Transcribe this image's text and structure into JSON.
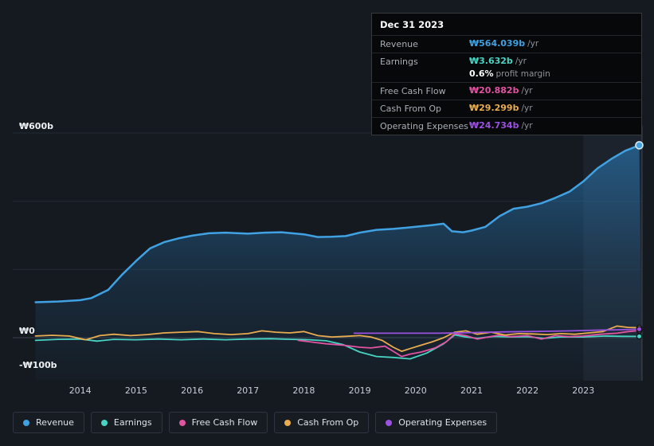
{
  "colors": {
    "revenue": "#40a2e3",
    "earnings": "#47d4c3",
    "free_cash_flow": "#e253a2",
    "cash_from_op": "#e9ac4f",
    "operating_expenses": "#9b51e0"
  },
  "tooltip": {
    "date": "Dec 31 2023",
    "rows": [
      {
        "label": "Revenue",
        "value": "₩564.039b",
        "suffix": "/yr"
      },
      {
        "label": "Earnings",
        "value": "₩3.632b",
        "suffix": "/yr"
      },
      {
        "label": "Free Cash Flow",
        "value": "₩20.882b",
        "suffix": "/yr"
      },
      {
        "label": "Cash From Op",
        "value": "₩29.299b",
        "suffix": "/yr"
      },
      {
        "label": "Operating Expenses",
        "value": "₩24.734b",
        "suffix": "/yr"
      }
    ],
    "margin": {
      "value": "0.6%",
      "label": "profit margin"
    }
  },
  "legend": {
    "items": [
      {
        "label": "Revenue"
      },
      {
        "label": "Earnings"
      },
      {
        "label": "Free Cash Flow"
      },
      {
        "label": "Cash From Op"
      },
      {
        "label": "Operating Expenses"
      }
    ]
  },
  "chart_data": {
    "type": "line",
    "title": "",
    "currency_unit": "₩ billions /yr",
    "x_axis": {
      "range": [
        2012.85,
        2024.05
      ],
      "ticks": [
        "2014",
        "2015",
        "2016",
        "2017",
        "2018",
        "2019",
        "2020",
        "2021",
        "2022",
        "2023"
      ],
      "tick_values": [
        2014,
        2015,
        2016,
        2017,
        2018,
        2019,
        2020,
        2021,
        2022,
        2023
      ]
    },
    "y_axis": {
      "range": [
        -120,
        640
      ],
      "gridlines": [
        600,
        400,
        200,
        0
      ],
      "labels": [
        {
          "text": "₩600b",
          "value": 600
        },
        {
          "text": "₩0",
          "value": 0
        },
        {
          "text": "-₩100b",
          "value": -100
        }
      ]
    },
    "highlight_from_x": 2023,
    "series": [
      {
        "name": "Revenue",
        "color": "#40a2e3",
        "fill": true,
        "x": [
          2013.2,
          2013.6,
          2014.0,
          2014.2,
          2014.5,
          2014.75,
          2015.0,
          2015.25,
          2015.5,
          2015.75,
          2016.0,
          2016.3,
          2016.6,
          2017.0,
          2017.3,
          2017.6,
          2018.0,
          2018.25,
          2018.5,
          2018.75,
          2019.0,
          2019.3,
          2019.6,
          2020.0,
          2020.3,
          2020.5,
          2020.65,
          2020.85,
          2021.0,
          2021.25,
          2021.5,
          2021.75,
          2022.0,
          2022.25,
          2022.5,
          2022.75,
          2023.0,
          2023.25,
          2023.5,
          2023.75,
          2024.0
        ],
        "values": [
          104,
          106,
          110,
          116,
          140,
          185,
          225,
          262,
          280,
          291,
          299,
          306,
          308,
          305,
          308,
          309,
          303,
          295,
          296,
          298,
          308,
          316,
          319,
          325,
          330,
          334,
          312,
          309,
          314,
          325,
          356,
          378,
          384,
          394,
          410,
          428,
          458,
          496,
          524,
          548,
          564.039
        ]
      },
      {
        "name": "Earnings",
        "color": "#47d4c3",
        "x": [
          2013.2,
          2013.6,
          2014.0,
          2014.3,
          2014.6,
          2015.0,
          2015.4,
          2015.8,
          2016.2,
          2016.6,
          2017.0,
          2017.4,
          2017.8,
          2018.1,
          2018.4,
          2018.7,
          2019.0,
          2019.3,
          2019.6,
          2019.9,
          2020.2,
          2020.5,
          2020.7,
          2020.9,
          2021.1,
          2021.4,
          2021.7,
          2022.0,
          2022.3,
          2022.6,
          2023.0,
          2023.4,
          2023.7,
          2024.0
        ],
        "values": [
          -8,
          -5,
          -4,
          -10,
          -5,
          -6,
          -4,
          -6,
          -4,
          -6,
          -4,
          -3,
          -5,
          -6,
          -9,
          -20,
          -42,
          -55,
          -58,
          -62,
          -45,
          -18,
          8,
          2,
          -2,
          4,
          2,
          3,
          -2,
          2,
          2,
          5,
          4,
          3.632
        ]
      },
      {
        "name": "Free Cash Flow",
        "color": "#e253a2",
        "x": [
          2017.9,
          2018.1,
          2018.4,
          2018.7,
          2019.0,
          2019.2,
          2019.45,
          2019.6,
          2019.75,
          2019.9,
          2020.1,
          2020.35,
          2020.55,
          2020.7,
          2020.9,
          2021.1,
          2021.3,
          2021.5,
          2021.7,
          2022.0,
          2022.25,
          2022.5,
          2022.75,
          2023.0,
          2023.3,
          2023.6,
          2023.8,
          2024.0
        ],
        "values": [
          -8,
          -12,
          -18,
          -22,
          -28,
          -30,
          -25,
          -40,
          -55,
          -48,
          -42,
          -30,
          -12,
          12,
          6,
          -4,
          2,
          8,
          3,
          6,
          -4,
          6,
          3,
          5,
          10,
          13,
          18,
          20.882
        ]
      },
      {
        "name": "Cash From Op",
        "color": "#e9ac4f",
        "x": [
          2013.2,
          2013.5,
          2013.8,
          2014.1,
          2014.35,
          2014.6,
          2014.9,
          2015.2,
          2015.5,
          2015.8,
          2016.1,
          2016.4,
          2016.7,
          2017.0,
          2017.25,
          2017.5,
          2017.75,
          2018.0,
          2018.25,
          2018.5,
          2018.75,
          2019.0,
          2019.2,
          2019.4,
          2019.6,
          2019.75,
          2019.9,
          2020.1,
          2020.3,
          2020.5,
          2020.7,
          2020.9,
          2021.1,
          2021.35,
          2021.6,
          2021.85,
          2022.1,
          2022.35,
          2022.6,
          2022.85,
          2023.1,
          2023.35,
          2023.6,
          2023.8,
          2024.0
        ],
        "values": [
          5,
          7,
          5,
          -6,
          6,
          10,
          6,
          9,
          14,
          16,
          18,
          12,
          9,
          12,
          20,
          16,
          14,
          18,
          6,
          2,
          4,
          6,
          2,
          -8,
          -28,
          -40,
          -32,
          -22,
          -12,
          0,
          16,
          20,
          10,
          16,
          8,
          12,
          11,
          9,
          12,
          10,
          14,
          18,
          34,
          30,
          29.299
        ]
      },
      {
        "name": "Operating Expenses",
        "color": "#9b51e0",
        "x": [
          2018.9,
          2019.2,
          2019.5,
          2019.8,
          2020.1,
          2020.4,
          2020.7,
          2021.0,
          2021.3,
          2021.6,
          2022.0,
          2022.4,
          2022.8,
          2023.2,
          2023.6,
          2024.0
        ],
        "values": [
          13,
          13,
          13,
          13,
          13,
          13,
          14,
          15,
          16,
          17,
          18,
          19,
          20,
          22,
          23,
          24.734
        ]
      }
    ]
  }
}
